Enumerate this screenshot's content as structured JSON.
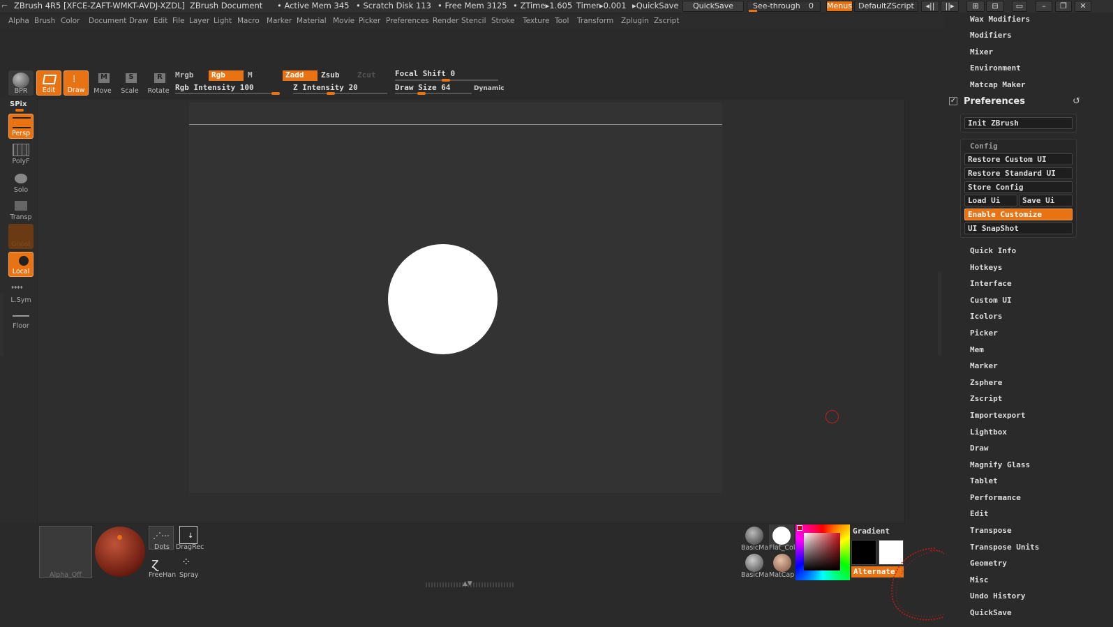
{
  "title_bar": {
    "app": "ZBrush 4R5 [XFCE-ZAFT-WMKT-AVDJ-XZDL]",
    "document": "ZBrush Document",
    "active_mem": "• Active Mem 345",
    "scratch_disk": "• Scratch Disk 113",
    "free_mem": "• Free Mem 3125",
    "ztime": "• ZTime▸1.605",
    "timer": "Timer▸0.001",
    "quicksave_text": "▸QuickSave",
    "quicksave_button": "QuickSave",
    "see_through": "See-through",
    "see_through_value": "0",
    "menus_button": "Menus",
    "script_name": "DefaultZScript"
  },
  "menu_bar": [
    "Alpha",
    "Brush",
    "Color",
    "Document",
    "Draw",
    "Edit",
    "File",
    "Layer",
    "Light",
    "Macro",
    "Marker",
    "Material",
    "Movie",
    "Picker",
    "Preferences",
    "Render",
    "Stencil",
    "Stroke",
    "Texture",
    "Tool",
    "Transform",
    "Zplugin",
    "Zscript"
  ],
  "toolbar": {
    "bpr": "BPR",
    "edit": "Edit",
    "draw": "Draw",
    "move": "Move",
    "scale": "Scale",
    "rotate": "Rotate",
    "mrgb": "Mrgb",
    "rgb": "Rgb",
    "m": "M",
    "zadd": "Zadd",
    "zsub": "Zsub",
    "zcut": "Zcut",
    "rgb_intensity_label": "Rgb Intensity",
    "rgb_intensity_value": "100",
    "z_intensity_label": "Z Intensity",
    "z_intensity_value": "20",
    "focal_shift_label": "Focal Shift",
    "focal_shift_value": "0",
    "draw_size_label": "Draw Size",
    "draw_size_value": "64",
    "dynamic": "Dynamic"
  },
  "left_shelf": {
    "spix": "SPix",
    "persp": "Persp",
    "polyf": "PolyF",
    "solo": "Solo",
    "transp": "Transp",
    "ghost": "Ghost",
    "local": "Local",
    "lsym": "L.Sym",
    "floor": "Floor"
  },
  "bottom_shelf": {
    "alpha": "Alpha_Off",
    "dots": "Dots",
    "dragrect": "DragRec",
    "freehand": "FreeHan",
    "spray": "Spray",
    "mat1": "BasicMa",
    "mat2": "Flat_Col",
    "mat3": "BasicMa",
    "mat4": "MatCap",
    "gradient": "Gradient",
    "alternate": "Alternate"
  },
  "right_panel": {
    "top_items": [
      "Wax Modifiers",
      "Modifiers",
      "Mixer",
      "Environment",
      "Matcap Maker"
    ],
    "preferences_title": "Preferences",
    "init_zbrush": "Init ZBrush",
    "config_title": "Config",
    "restore_custom": "Restore Custom UI",
    "restore_standard": "Restore Standard UI",
    "store_config": "Store Config",
    "load_ui": "Load Ui",
    "save_ui": "Save Ui",
    "enable_customize": "Enable Customize",
    "ui_snapshot": "UI SnapShot",
    "items": [
      "Quick Info",
      "Hotkeys",
      "Interface",
      "Custom UI",
      "Icolors",
      "Picker",
      "Mem",
      "Marker",
      "Zsphere",
      "Zscript",
      "Importexport",
      "Lightbox",
      "Draw",
      "Magnify Glass",
      "Tablet",
      "Performance",
      "Edit",
      "Transpose",
      "Transpose Units",
      "Geometry",
      "Misc",
      "Undo History",
      "QuickSave"
    ]
  },
  "colors": {
    "accent": "#e97313",
    "background": "#2a2a2a",
    "document": "#333333"
  }
}
